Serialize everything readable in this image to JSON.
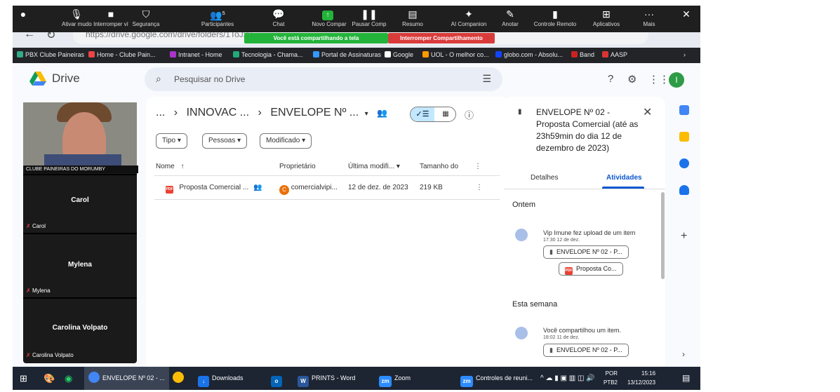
{
  "browser": {
    "url": "https://drive.google.com/drive/folders/1ToJxv...",
    "bookmarks": [
      "PBX Clube Paineiras",
      "Home - Clube Pain...",
      "Intranet - Home",
      "Tecnologia - Chama...",
      "Portal de Assinaturas",
      "Google",
      "UOL - O melhor co...",
      "globo.com - Absolu...",
      "Band",
      "AASP"
    ]
  },
  "zoom_toolbar": {
    "items": [
      {
        "label": "Ativar mudo",
        "icon": "microphone-icon"
      },
      {
        "label": "Interromper ví",
        "icon": "video-icon"
      },
      {
        "label": "Segurança",
        "icon": "shield-icon"
      },
      {
        "label": "Participantes",
        "icon": "participants-icon",
        "count": "5"
      },
      {
        "label": "Chat",
        "icon": "chat-icon"
      },
      {
        "label": "Novo Compar",
        "icon": "share-icon"
      },
      {
        "label": "Pausar Comp",
        "icon": "pause-icon"
      },
      {
        "label": "Resumo",
        "icon": "summary-icon"
      },
      {
        "label": "AI Companion",
        "icon": "ai-icon"
      },
      {
        "label": "Anotar",
        "icon": "pen-icon"
      },
      {
        "label": "Controle Remoto",
        "icon": "remote-icon"
      },
      {
        "label": "Aplicativos",
        "icon": "apps-icon"
      },
      {
        "label": "Mais",
        "icon": "more-icon"
      }
    ],
    "sharing_banner": "Você está compartilhando a tela",
    "stop_share": "Interromper Compartilhamento"
  },
  "drive": {
    "logo_text": "Drive",
    "search_placeholder": "Pesquisar no Drive",
    "avatar_initial": "I",
    "breadcrumb": {
      "more": "...",
      "parent": "INNOVAC ...",
      "current": "ENVELOPE Nº ..."
    },
    "filters": [
      "Tipo",
      "Pessoas",
      "Modificado"
    ],
    "columns": {
      "name": "Nome",
      "owner": "Proprietário",
      "modified": "Última modifi...",
      "size": "Tamanho do"
    },
    "files": [
      {
        "name": "Proposta Comercial ...",
        "owner_initial": "C",
        "owner": "comercialvipi...",
        "modified": "12 de dez. de 2023",
        "size": "219 KB"
      }
    ],
    "details": {
      "title": "ENVELOPE Nº 02 - Proposta Comercial (até as 23h59min do dia 12 de dezembro de 2023)",
      "tabs": [
        "Detalhes",
        "Atividades"
      ],
      "activity": [
        {
          "day": "Ontem",
          "text": "Vip Imune fez upload de um item",
          "time": "17:30 12 de dez.",
          "folder": "ENVELOPE Nº 02 - P...",
          "file": "Proposta Co..."
        },
        {
          "day": "Esta semana",
          "text": "Você compartilhou um item.",
          "time": "18:02 11 de dez.",
          "folder": "ENVELOPE Nº 02 - P..."
        }
      ]
    }
  },
  "participants": {
    "video_label": "CLUBE PAINEIRAS DO MORUMBY",
    "people": [
      {
        "name": "Carol",
        "mic_label": "Carol"
      },
      {
        "name": "Mylena",
        "mic_label": "Mylena"
      },
      {
        "name": "Carolina Volpato",
        "mic_label": "Carolina Volpato"
      }
    ]
  },
  "taskbar": {
    "items": [
      "ENVELOPE Nº 02 - ...",
      "Downloads",
      "PRINTS - Word",
      "Zoom",
      "Controles de reuni..."
    ],
    "lang": "POR",
    "lang2": "PTB2",
    "time": "15:16",
    "date": "13/12/2023"
  }
}
